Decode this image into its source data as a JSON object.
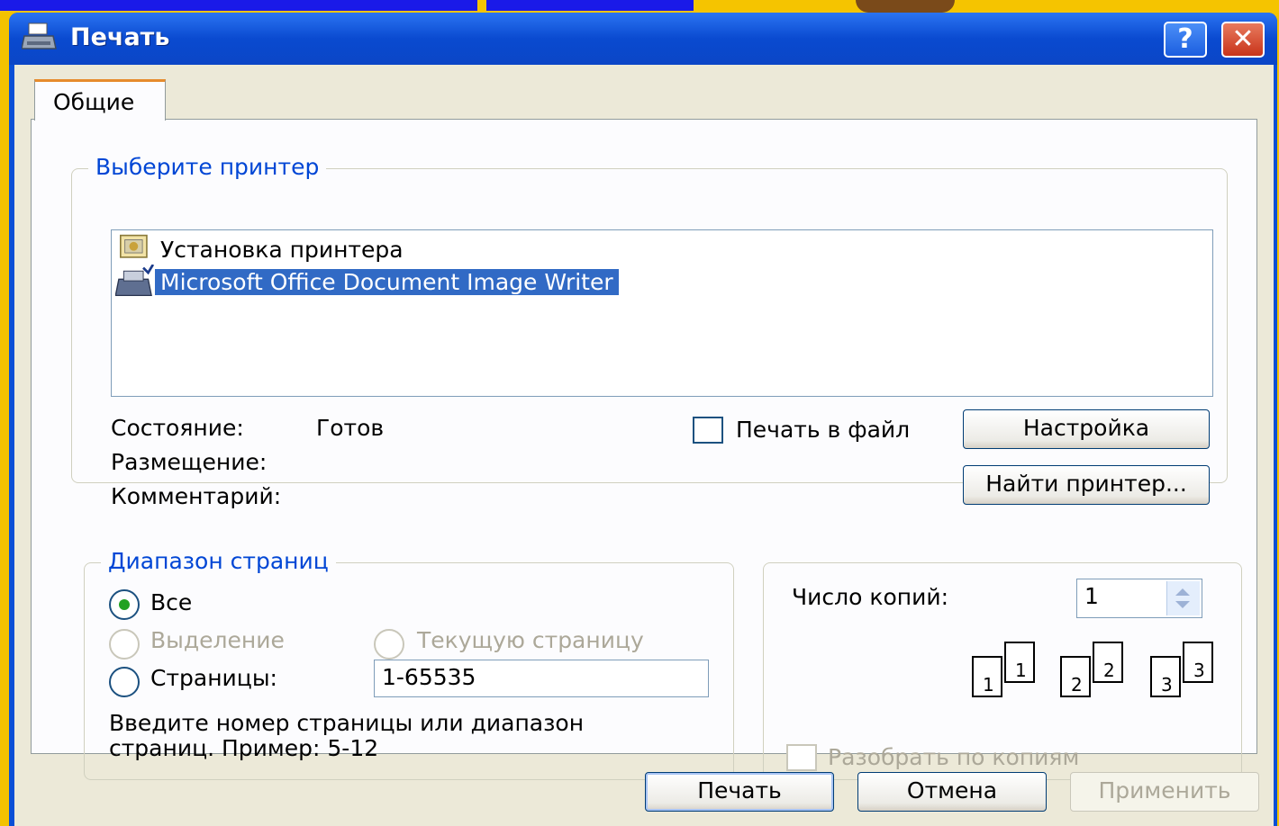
{
  "window": {
    "title": "Печать",
    "help_label": "?",
    "close_label": "✕"
  },
  "tabs": [
    {
      "label": "Общие",
      "active": true
    }
  ],
  "printer_group": {
    "legend": "Выберите принтер",
    "printers": [
      {
        "label": "Установка принтера",
        "icon": "add-printer-icon",
        "selected": false
      },
      {
        "label": "Microsoft Office Document Image Writer",
        "icon": "printer-icon",
        "selected": true
      }
    ],
    "status_label": "Состояние:",
    "status_value": "Готов",
    "location_label": "Размещение:",
    "location_value": "",
    "comment_label": "Комментарий:",
    "comment_value": "",
    "print_to_file_label": "Печать в файл",
    "print_to_file_checked": false,
    "settings_button": "Настройка",
    "find_printer_button": "Найти принтер..."
  },
  "page_range": {
    "legend": "Диапазон страниц",
    "all_label": "Все",
    "selection_label": "Выделение",
    "current_page_label": "Текущую страницу",
    "pages_label": "Страницы:",
    "pages_value": "1-65535",
    "selected_option": "all",
    "hint_line1": "Введите номер страницы или диапазон",
    "hint_line2": "страниц.  Пример: 5-12"
  },
  "copies": {
    "label": "Число копий:",
    "value": "1",
    "collate_label": "Разобрать по копиям",
    "collate_checked": false,
    "collate_pages": [
      "1",
      "1",
      "2",
      "2",
      "3",
      "3"
    ]
  },
  "footer": {
    "print_button": "Печать",
    "cancel_button": "Отмена",
    "apply_button": "Применить"
  },
  "colors": {
    "titlebar": "#0a4fd6",
    "dialog_bg": "#ece9d8",
    "group_legend": "#0046d5",
    "selection": "#316ac5",
    "background": "#f3c200"
  }
}
